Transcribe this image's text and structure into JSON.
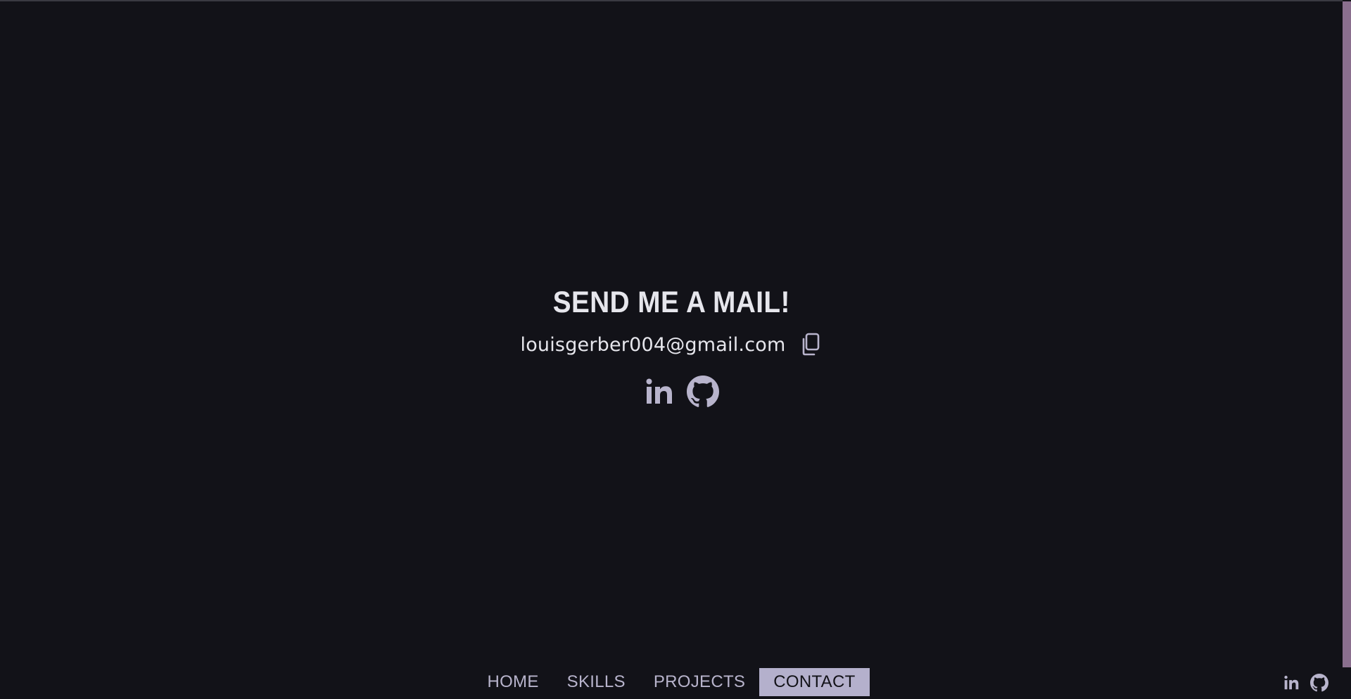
{
  "contact": {
    "heading": "SEND ME A MAIL!",
    "email": "louisgerber004@gmail.com"
  },
  "icons": {
    "copy": "copy-icon",
    "linkedin": "linkedin-icon",
    "github": "github-icon"
  },
  "nav": {
    "items": [
      {
        "label": "HOME",
        "active": false
      },
      {
        "label": "SKILLS",
        "active": false
      },
      {
        "label": "PROJECTS",
        "active": false
      },
      {
        "label": "CONTACT",
        "active": true
      }
    ]
  },
  "colors": {
    "background": "#121218",
    "text": "#e6e6ec",
    "accent": "#b4b0cc",
    "icon": "#b8b4cc",
    "scrollbar": "#8a6f8e"
  }
}
